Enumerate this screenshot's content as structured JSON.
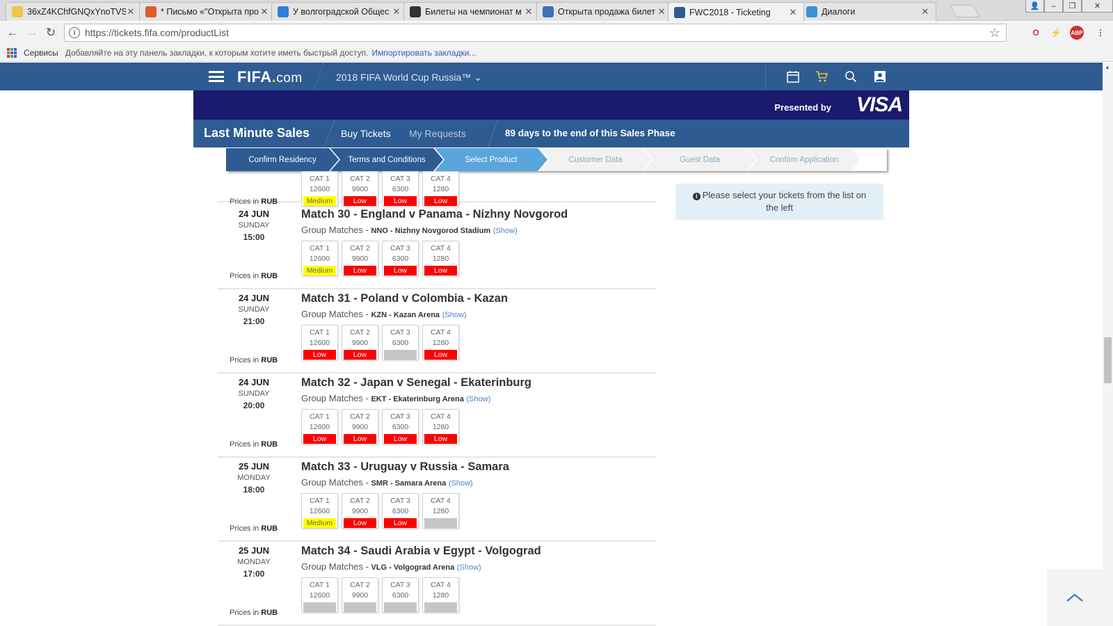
{
  "browser": {
    "tabs": [
      {
        "title": "36xZ4KChfGNQxYnoTVS",
        "icon_color": "#f0c44c"
      },
      {
        "title": "* Письмо «\"Открыта про",
        "icon_color": "#e25a2d"
      },
      {
        "title": "У волгоградской Общес",
        "icon_color": "#2f7fd6"
      },
      {
        "title": "Билеты на чемпионат м",
        "icon_color": "#333333"
      },
      {
        "title": "Открыта продажа билет",
        "icon_color": "#3b6fb6"
      },
      {
        "title": "FWC2018 - Ticketing",
        "icon_color": "#2e5b92"
      },
      {
        "title": "Диалоги",
        "icon_color": "#3b8fd6"
      }
    ],
    "url": "https://tickets.fifa.com/productList",
    "bookmarks": {
      "apps_label": "Сервисы",
      "hint": "Добавляйте на эту панель закладки, к которым хотите иметь быстрый доступ.",
      "import_link": "Импортировать закладки..."
    }
  },
  "site": {
    "logo_main": "FIFA",
    "logo_com": "com",
    "tournament": "2018 FIFA World Cup Russia™",
    "presented_by": "Presented by",
    "sponsor": "VISA",
    "section_title": "Last Minute Sales",
    "nav_buy": "Buy Tickets",
    "nav_requests": "My Requests",
    "days_left": "89 days to the end of this Sales Phase"
  },
  "steps": [
    {
      "label": "Confirm Residency",
      "state": "done"
    },
    {
      "label": "Terms and Conditions",
      "state": "done"
    },
    {
      "label": "Select Product",
      "state": "current"
    },
    {
      "label": "Customer Data",
      "state": "todo"
    },
    {
      "label": "Guest Data",
      "state": "todo"
    },
    {
      "label": "Confirm Application",
      "state": "todo"
    }
  ],
  "info_message": "Please select your tickets from the list on the left",
  "prices_label": "Prices in",
  "currency": "RUB",
  "show_label": "(Show)",
  "partial_match": {
    "cats": [
      {
        "label": "CAT 1",
        "price": "12600",
        "availability": "Medium"
      },
      {
        "label": "CAT 2",
        "price": "9900",
        "availability": "Low"
      },
      {
        "label": "CAT 3",
        "price": "6300",
        "availability": "Low"
      },
      {
        "label": "CAT 4",
        "price": "1280",
        "availability": "Low"
      }
    ]
  },
  "matches": [
    {
      "date": "24 JUN",
      "day": "SUNDAY",
      "time": "15:00",
      "title": "Match 30 - England v Panama - Nizhny Novgorod",
      "stage": "Group Matches",
      "venue": "NNO - Nizhny Novgorod Stadium",
      "cats": [
        {
          "label": "CAT 1",
          "price": "12600",
          "availability": "Medium"
        },
        {
          "label": "CAT 2",
          "price": "9900",
          "availability": "Low"
        },
        {
          "label": "CAT 3",
          "price": "6300",
          "availability": "Low"
        },
        {
          "label": "CAT 4",
          "price": "1280",
          "availability": "Low"
        }
      ]
    },
    {
      "date": "24 JUN",
      "day": "SUNDAY",
      "time": "21:00",
      "title": "Match 31 - Poland v Colombia - Kazan",
      "stage": "Group Matches",
      "venue": "KZN - Kazan Arena",
      "cats": [
        {
          "label": "CAT 1",
          "price": "12600",
          "availability": "Low"
        },
        {
          "label": "CAT 2",
          "price": "9900",
          "availability": "Low"
        },
        {
          "label": "CAT 3",
          "price": "6300",
          "availability": ""
        },
        {
          "label": "CAT 4",
          "price": "1280",
          "availability": "Low"
        }
      ]
    },
    {
      "date": "24 JUN",
      "day": "SUNDAY",
      "time": "20:00",
      "title": "Match 32 - Japan v Senegal - Ekaterinburg",
      "stage": "Group Matches",
      "venue": "EKT - Ekaterinburg Arena",
      "cats": [
        {
          "label": "CAT 1",
          "price": "12600",
          "availability": "Low"
        },
        {
          "label": "CAT 2",
          "price": "9900",
          "availability": "Low"
        },
        {
          "label": "CAT 3",
          "price": "6300",
          "availability": "Low"
        },
        {
          "label": "CAT 4",
          "price": "1280",
          "availability": "Low"
        }
      ]
    },
    {
      "date": "25 JUN",
      "day": "MONDAY",
      "time": "18:00",
      "title": "Match 33 - Uruguay v Russia - Samara",
      "stage": "Group Matches",
      "venue": "SMR - Samara Arena",
      "cats": [
        {
          "label": "CAT 1",
          "price": "12600",
          "availability": "Medium"
        },
        {
          "label": "CAT 2",
          "price": "9900",
          "availability": "Low"
        },
        {
          "label": "CAT 3",
          "price": "6300",
          "availability": "Low"
        },
        {
          "label": "CAT 4",
          "price": "1280",
          "availability": ""
        }
      ]
    },
    {
      "date": "25 JUN",
      "day": "MONDAY",
      "time": "17:00",
      "title": "Match 34 - Saudi Arabia v Egypt - Volgograd",
      "stage": "Group Matches",
      "venue": "VLG - Volgograd Arena",
      "cats": [
        {
          "label": "CAT 1",
          "price": "12600",
          "availability": ""
        },
        {
          "label": "CAT 2",
          "price": "9900",
          "availability": ""
        },
        {
          "label": "CAT 3",
          "price": "6300",
          "availability": ""
        },
        {
          "label": "CAT 4",
          "price": "1280",
          "availability": ""
        }
      ]
    }
  ]
}
